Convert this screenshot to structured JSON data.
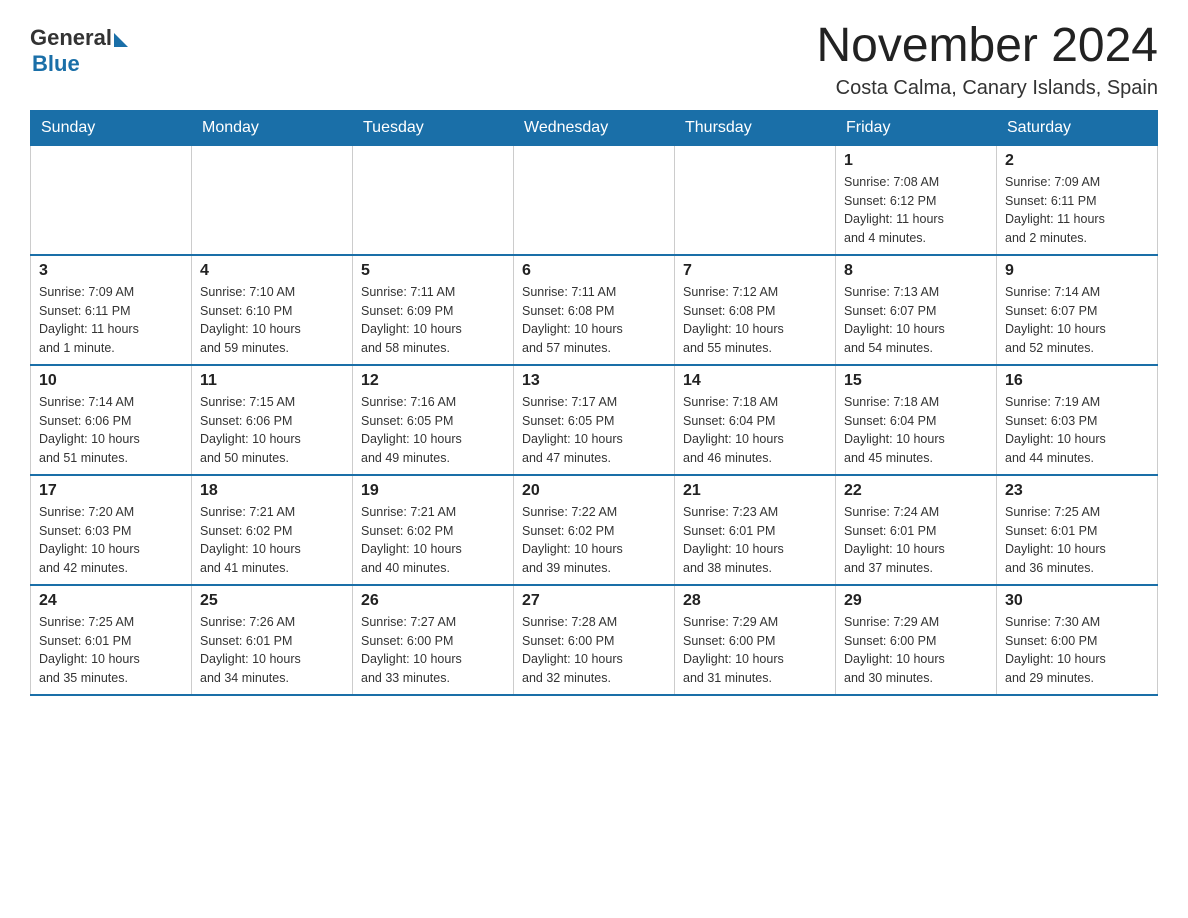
{
  "logo": {
    "general": "General",
    "blue": "Blue"
  },
  "title": "November 2024",
  "subtitle": "Costa Calma, Canary Islands, Spain",
  "weekdays": [
    "Sunday",
    "Monday",
    "Tuesday",
    "Wednesday",
    "Thursday",
    "Friday",
    "Saturday"
  ],
  "weeks": [
    [
      {
        "day": "",
        "detail": ""
      },
      {
        "day": "",
        "detail": ""
      },
      {
        "day": "",
        "detail": ""
      },
      {
        "day": "",
        "detail": ""
      },
      {
        "day": "",
        "detail": ""
      },
      {
        "day": "1",
        "detail": "Sunrise: 7:08 AM\nSunset: 6:12 PM\nDaylight: 11 hours\nand 4 minutes."
      },
      {
        "day": "2",
        "detail": "Sunrise: 7:09 AM\nSunset: 6:11 PM\nDaylight: 11 hours\nand 2 minutes."
      }
    ],
    [
      {
        "day": "3",
        "detail": "Sunrise: 7:09 AM\nSunset: 6:11 PM\nDaylight: 11 hours\nand 1 minute."
      },
      {
        "day": "4",
        "detail": "Sunrise: 7:10 AM\nSunset: 6:10 PM\nDaylight: 10 hours\nand 59 minutes."
      },
      {
        "day": "5",
        "detail": "Sunrise: 7:11 AM\nSunset: 6:09 PM\nDaylight: 10 hours\nand 58 minutes."
      },
      {
        "day": "6",
        "detail": "Sunrise: 7:11 AM\nSunset: 6:08 PM\nDaylight: 10 hours\nand 57 minutes."
      },
      {
        "day": "7",
        "detail": "Sunrise: 7:12 AM\nSunset: 6:08 PM\nDaylight: 10 hours\nand 55 minutes."
      },
      {
        "day": "8",
        "detail": "Sunrise: 7:13 AM\nSunset: 6:07 PM\nDaylight: 10 hours\nand 54 minutes."
      },
      {
        "day": "9",
        "detail": "Sunrise: 7:14 AM\nSunset: 6:07 PM\nDaylight: 10 hours\nand 52 minutes."
      }
    ],
    [
      {
        "day": "10",
        "detail": "Sunrise: 7:14 AM\nSunset: 6:06 PM\nDaylight: 10 hours\nand 51 minutes."
      },
      {
        "day": "11",
        "detail": "Sunrise: 7:15 AM\nSunset: 6:06 PM\nDaylight: 10 hours\nand 50 minutes."
      },
      {
        "day": "12",
        "detail": "Sunrise: 7:16 AM\nSunset: 6:05 PM\nDaylight: 10 hours\nand 49 minutes."
      },
      {
        "day": "13",
        "detail": "Sunrise: 7:17 AM\nSunset: 6:05 PM\nDaylight: 10 hours\nand 47 minutes."
      },
      {
        "day": "14",
        "detail": "Sunrise: 7:18 AM\nSunset: 6:04 PM\nDaylight: 10 hours\nand 46 minutes."
      },
      {
        "day": "15",
        "detail": "Sunrise: 7:18 AM\nSunset: 6:04 PM\nDaylight: 10 hours\nand 45 minutes."
      },
      {
        "day": "16",
        "detail": "Sunrise: 7:19 AM\nSunset: 6:03 PM\nDaylight: 10 hours\nand 44 minutes."
      }
    ],
    [
      {
        "day": "17",
        "detail": "Sunrise: 7:20 AM\nSunset: 6:03 PM\nDaylight: 10 hours\nand 42 minutes."
      },
      {
        "day": "18",
        "detail": "Sunrise: 7:21 AM\nSunset: 6:02 PM\nDaylight: 10 hours\nand 41 minutes."
      },
      {
        "day": "19",
        "detail": "Sunrise: 7:21 AM\nSunset: 6:02 PM\nDaylight: 10 hours\nand 40 minutes."
      },
      {
        "day": "20",
        "detail": "Sunrise: 7:22 AM\nSunset: 6:02 PM\nDaylight: 10 hours\nand 39 minutes."
      },
      {
        "day": "21",
        "detail": "Sunrise: 7:23 AM\nSunset: 6:01 PM\nDaylight: 10 hours\nand 38 minutes."
      },
      {
        "day": "22",
        "detail": "Sunrise: 7:24 AM\nSunset: 6:01 PM\nDaylight: 10 hours\nand 37 minutes."
      },
      {
        "day": "23",
        "detail": "Sunrise: 7:25 AM\nSunset: 6:01 PM\nDaylight: 10 hours\nand 36 minutes."
      }
    ],
    [
      {
        "day": "24",
        "detail": "Sunrise: 7:25 AM\nSunset: 6:01 PM\nDaylight: 10 hours\nand 35 minutes."
      },
      {
        "day": "25",
        "detail": "Sunrise: 7:26 AM\nSunset: 6:01 PM\nDaylight: 10 hours\nand 34 minutes."
      },
      {
        "day": "26",
        "detail": "Sunrise: 7:27 AM\nSunset: 6:00 PM\nDaylight: 10 hours\nand 33 minutes."
      },
      {
        "day": "27",
        "detail": "Sunrise: 7:28 AM\nSunset: 6:00 PM\nDaylight: 10 hours\nand 32 minutes."
      },
      {
        "day": "28",
        "detail": "Sunrise: 7:29 AM\nSunset: 6:00 PM\nDaylight: 10 hours\nand 31 minutes."
      },
      {
        "day": "29",
        "detail": "Sunrise: 7:29 AM\nSunset: 6:00 PM\nDaylight: 10 hours\nand 30 minutes."
      },
      {
        "day": "30",
        "detail": "Sunrise: 7:30 AM\nSunset: 6:00 PM\nDaylight: 10 hours\nand 29 minutes."
      }
    ]
  ]
}
